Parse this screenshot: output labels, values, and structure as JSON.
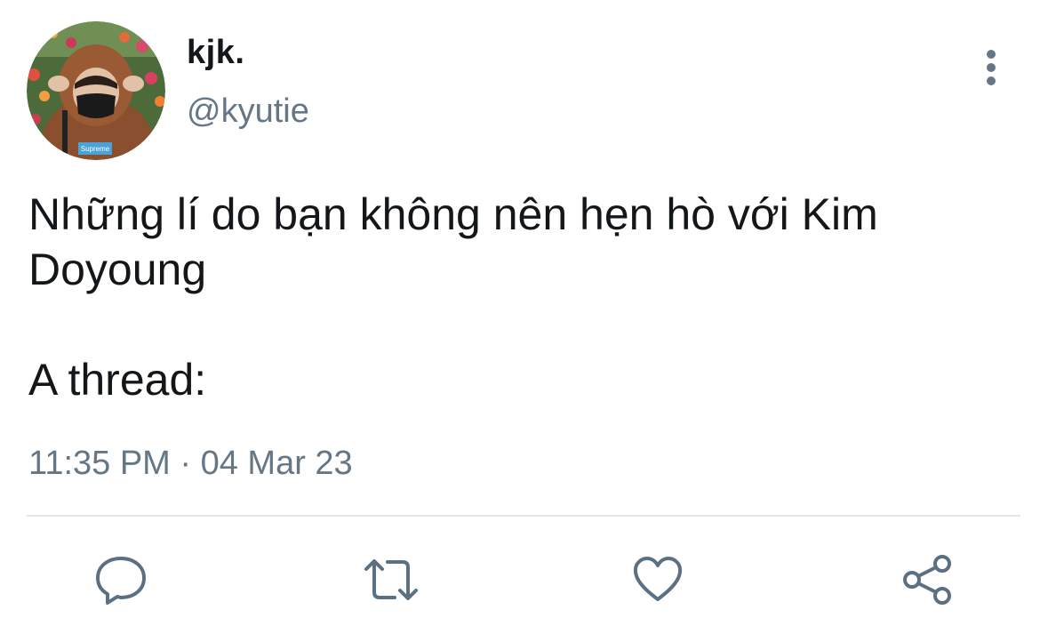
{
  "author": {
    "display_name": "kjk.",
    "handle": "@kyutie",
    "avatar_badge": "Supreme"
  },
  "tweet": {
    "text_lines": [
      "Những lí do bạn không nên hẹn hò với Kim",
      "Doyoung",
      "",
      "A thread:"
    ],
    "timestamp": "11:35 PM · 04 Mar 23"
  },
  "actions": [
    {
      "name": "reply",
      "icon": "reply-icon"
    },
    {
      "name": "retweet",
      "icon": "retweet-icon"
    },
    {
      "name": "like",
      "icon": "heart-icon"
    },
    {
      "name": "share",
      "icon": "share-icon"
    }
  ],
  "colors": {
    "text": "#14171a",
    "secondary": "#657786",
    "divider": "#e1e8ed",
    "icon": "#5b7083"
  }
}
